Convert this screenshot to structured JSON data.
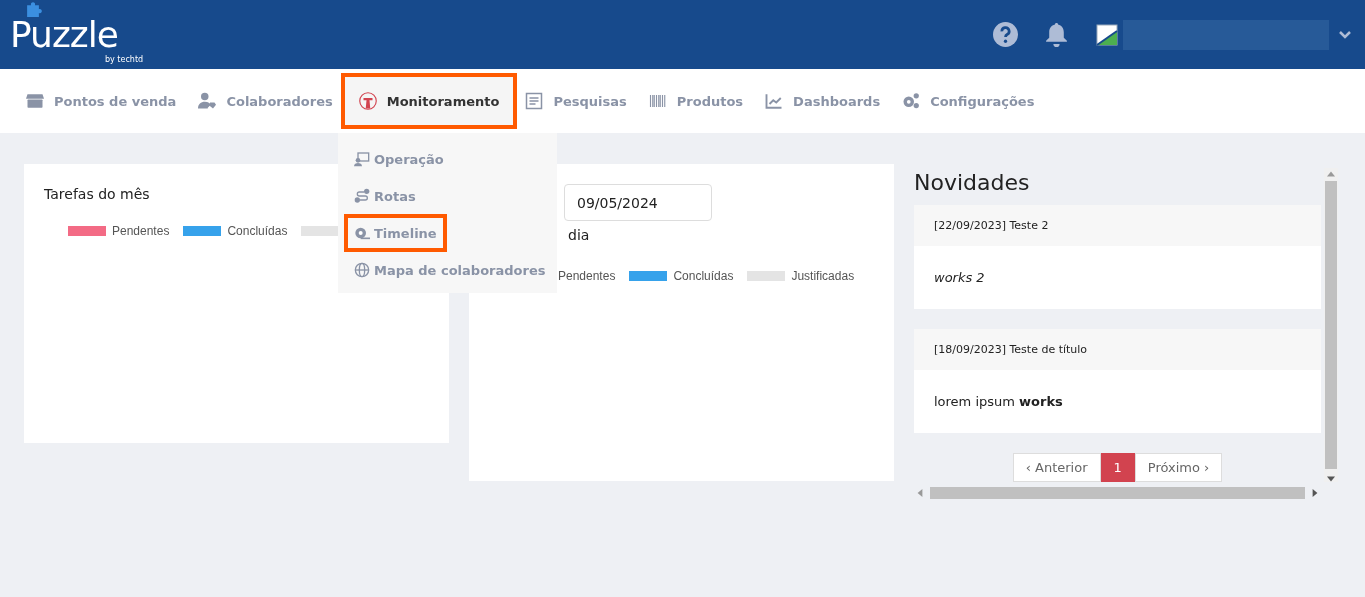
{
  "header": {
    "logo": "Puzzle",
    "logo_tagline": "by techtd"
  },
  "nav": {
    "items": [
      {
        "label": "Pontos de venda",
        "selected": false,
        "highlighted": false
      },
      {
        "label": "Colaboradores",
        "selected": false,
        "highlighted": false
      },
      {
        "label": "Monitoramento",
        "selected": true,
        "highlighted": true
      },
      {
        "label": "Pesquisas",
        "selected": false,
        "highlighted": false
      },
      {
        "label": "Produtos",
        "selected": false,
        "highlighted": false
      },
      {
        "label": "Dashboards",
        "selected": false,
        "highlighted": false
      },
      {
        "label": "Configurações",
        "selected": false,
        "highlighted": false
      }
    ]
  },
  "dropdown": {
    "items": [
      {
        "label": "Operação",
        "highlighted": false
      },
      {
        "label": "Rotas",
        "highlighted": false
      },
      {
        "label": "Timeline",
        "highlighted": true
      },
      {
        "label": "Mapa de colaboradores",
        "highlighted": false
      }
    ]
  },
  "month_card": {
    "title": "Tarefas do mês",
    "legend": [
      {
        "label": "Pendentes",
        "color": "#f36b85"
      },
      {
        "label": "Concluídas",
        "color": "#36a2eb"
      },
      {
        "color": "#e4e4e4"
      }
    ]
  },
  "day_card": {
    "date": "09/05/2024",
    "title": "dia",
    "legend": [
      {
        "label": "Pendentes"
      },
      {
        "label": "Concluídas",
        "color": "#36a2eb"
      },
      {
        "label": "Justificadas",
        "color": "#e4e4e4"
      }
    ]
  },
  "news": {
    "title": "Novidades",
    "posts": [
      {
        "title": "[22/09/2023] Teste 2",
        "body": "works 2",
        "kind": "emphasized"
      },
      {
        "title": "[18/09/2023] Teste de título",
        "body": "lorem ipsum **works**",
        "kind": "plain"
      }
    ],
    "pagination": {
      "previous": "‹ Anterior",
      "pages": [
        {
          "label": "1",
          "selected": true
        }
      ],
      "next": "Próximo ›"
    }
  }
}
